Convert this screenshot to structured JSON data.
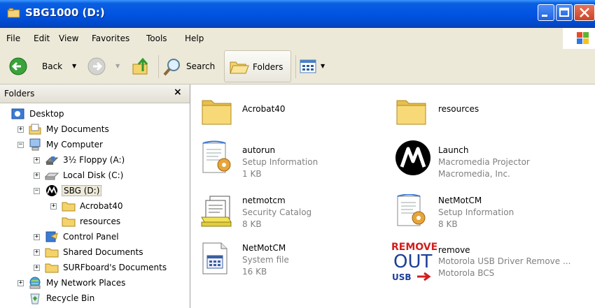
{
  "window": {
    "title": "SBG1000 (D:)"
  },
  "menu": [
    {
      "label": "File"
    },
    {
      "label": "Edit"
    },
    {
      "label": "View"
    },
    {
      "label": "Favorites"
    },
    {
      "label": "Tools"
    },
    {
      "label": "Help"
    }
  ],
  "toolbar": {
    "back_label": "Back",
    "search_label": "Search",
    "folders_label": "Folders"
  },
  "folders_pane": {
    "title": "Folders",
    "close_glyph": "×",
    "tree": [
      {
        "label": "Desktop",
        "icon": "desktop-icon"
      },
      {
        "label": "My Documents",
        "icon": "my-documents-icon",
        "expander": "+"
      },
      {
        "label": "My Computer",
        "icon": "my-computer-icon",
        "expander": "−"
      },
      {
        "label": "3½ Floppy (A:)",
        "icon": "floppy-icon",
        "expander": "+"
      },
      {
        "label": "Local Disk (C:)",
        "icon": "hard-disk-icon",
        "expander": "+"
      },
      {
        "label": "SBG (D:)",
        "icon": "motorola-logo-icon",
        "expander": "−",
        "selected": true
      },
      {
        "label": "Acrobat40",
        "icon": "folder-icon",
        "expander": "+"
      },
      {
        "label": "resources",
        "icon": "folder-icon"
      },
      {
        "label": "Control Panel",
        "icon": "control-panel-icon",
        "expander": "+"
      },
      {
        "label": "Shared Documents",
        "icon": "folder-icon",
        "expander": "+"
      },
      {
        "label": "SURFboard's Documents",
        "icon": "folder-icon",
        "expander": "+"
      },
      {
        "label": "My Network Places",
        "icon": "network-places-icon",
        "expander": "+"
      },
      {
        "label": "Recycle Bin",
        "icon": "recycle-bin-icon"
      }
    ]
  },
  "files": [
    {
      "name": "Acrobat40",
      "icon": "folder-icon"
    },
    {
      "name": "resources",
      "icon": "folder-icon"
    },
    {
      "name": "autorun",
      "type": "Setup Information",
      "size": "1 KB",
      "icon": "setup-information-icon"
    },
    {
      "name": "Launch",
      "type": "Macromedia Projector",
      "size": "Macromedia, Inc.",
      "icon": "motorola-logo-icon"
    },
    {
      "name": "netmotcm",
      "type": "Security Catalog",
      "size": "8 KB",
      "icon": "security-catalog-icon"
    },
    {
      "name": "NetMotCM",
      "type": "Setup Information",
      "size": "8 KB",
      "icon": "setup-information-icon"
    },
    {
      "name": "NetMotCM",
      "type": "System file",
      "size": "16 KB",
      "icon": "system-file-icon"
    },
    {
      "name": "remove",
      "type": "Motorola USB Driver Remove ...",
      "size": "Motorola BCS",
      "icon": "remove-usb-icon",
      "icon_text": [
        "REMOVE",
        "OUT",
        "USB"
      ]
    }
  ],
  "colors": {
    "title_bar": "#0054e3",
    "menu_bg": "#ece9d8",
    "folder_yellow": "#f5d36b",
    "subtext": "#808080"
  }
}
